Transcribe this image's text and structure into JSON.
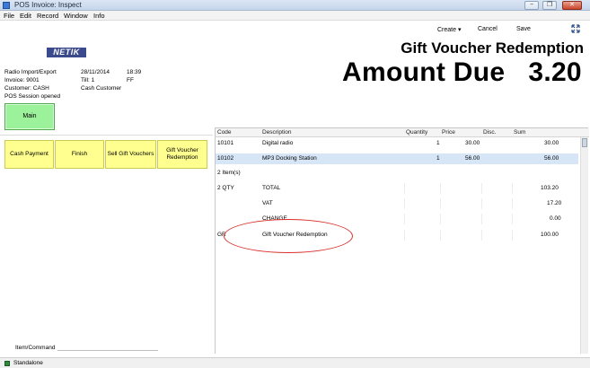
{
  "window": {
    "title": "POS Invoice: Inspect",
    "minimize_label": "−",
    "restore_label": "❐",
    "close_label": "✕"
  },
  "menu": [
    "File",
    "Edit",
    "Record",
    "Window",
    "Info"
  ],
  "toolbar": {
    "create": "Create ▾",
    "cancel": "Cancel",
    "save": "Save"
  },
  "logo_text": "NETIK",
  "heading": "Gift Voucher Redemption",
  "amount_due": {
    "label": "Amount Due",
    "value": "3.20"
  },
  "info": {
    "station": "Radio Import/Export",
    "date": "28/11/2014",
    "time": "18:39",
    "invoice": "Invoice: 9001",
    "till": "Till: 1",
    "operator": "FF",
    "customer": "Customer: CASH",
    "customer_name": "Cash Customer",
    "session": "POS Session opened"
  },
  "buttons": {
    "main": "Main",
    "cash_payment": "Cash Payment",
    "finish": "Finish",
    "sell_gift_vouchers": "Sell Gift Vouchers",
    "gv_line1": "Gift Voucher",
    "gv_line2": "Redemption"
  },
  "command_label": "Item/Command",
  "grid": {
    "headers": {
      "code": "Code",
      "description": "Description",
      "quantity": "Quantity",
      "price": "Price",
      "disc": "Disc.",
      "sum": "Sum"
    },
    "rows": [
      {
        "code": "10101",
        "description": "Digital radio",
        "qty": "1",
        "price": "30.00",
        "sum": "30.00"
      },
      {
        "code": "10102",
        "description": "MP3 Docking Station",
        "qty": "1",
        "price": "56.00",
        "sum": "56.00"
      }
    ],
    "item_count": "2 Item(s)",
    "total": {
      "code": "2 QTY",
      "label": "TOTAL",
      "value": "103.20"
    },
    "vat": {
      "label": "VAT",
      "value": "17.20"
    },
    "change": {
      "label": "CHANGE",
      "value": "0.00"
    },
    "gift": {
      "code": "GR",
      "label": "Gift Voucher Redemption",
      "value": "100.00"
    }
  },
  "status": "Standalone",
  "colors": {
    "main_button": "#9cf29a",
    "action_button": "#ffff8f",
    "selected_row": "#d7e6f7",
    "annotation_oval": "#d9302a"
  }
}
